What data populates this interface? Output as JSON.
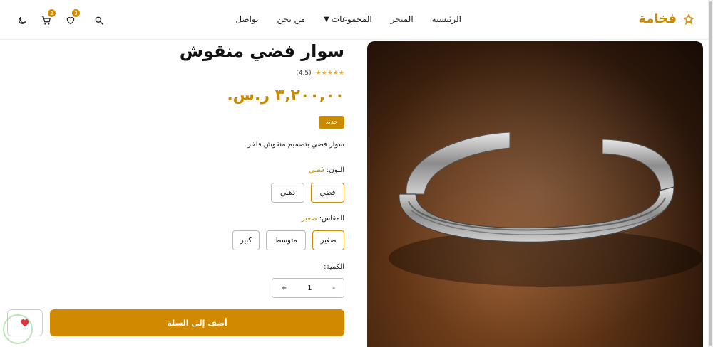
{
  "brand": {
    "name": "فخامة"
  },
  "nav": [
    {
      "label": "الرئيسية"
    },
    {
      "label": "المتجر"
    },
    {
      "label": "المجموعات",
      "dropdown": true
    },
    {
      "label": "من نحن"
    },
    {
      "label": "تواصل"
    }
  ],
  "header_icons": {
    "wishlist_count": "3",
    "cart_count": "2",
    "icons": [
      "search-icon",
      "heart-icon",
      "cart-icon",
      "moon-icon"
    ]
  },
  "product": {
    "title": "سوار فضي منقوش",
    "stars": "★★★★★",
    "rating": "(4.5)",
    "price": "٣,٢٠٠,٠٠ ر.س.",
    "tag": "جديد",
    "description": "سوار فضي بتصميم منقوش فاخر",
    "color_label": "اللون:",
    "color_value": "فضي",
    "colors": [
      "فضي",
      "ذهبي"
    ],
    "size_label": "المقاس:",
    "size_value": "صغير",
    "sizes": [
      "صغير",
      "متوسط",
      "كبير"
    ],
    "quantity_label": "الكمية:",
    "quantity": "1",
    "qty_minus": "-",
    "qty_plus": "+",
    "add_to_cart": "أضف إلى السلة"
  },
  "colors": {
    "accent": "#c98a00",
    "button": "#d18a00",
    "star": "#f4b400"
  }
}
